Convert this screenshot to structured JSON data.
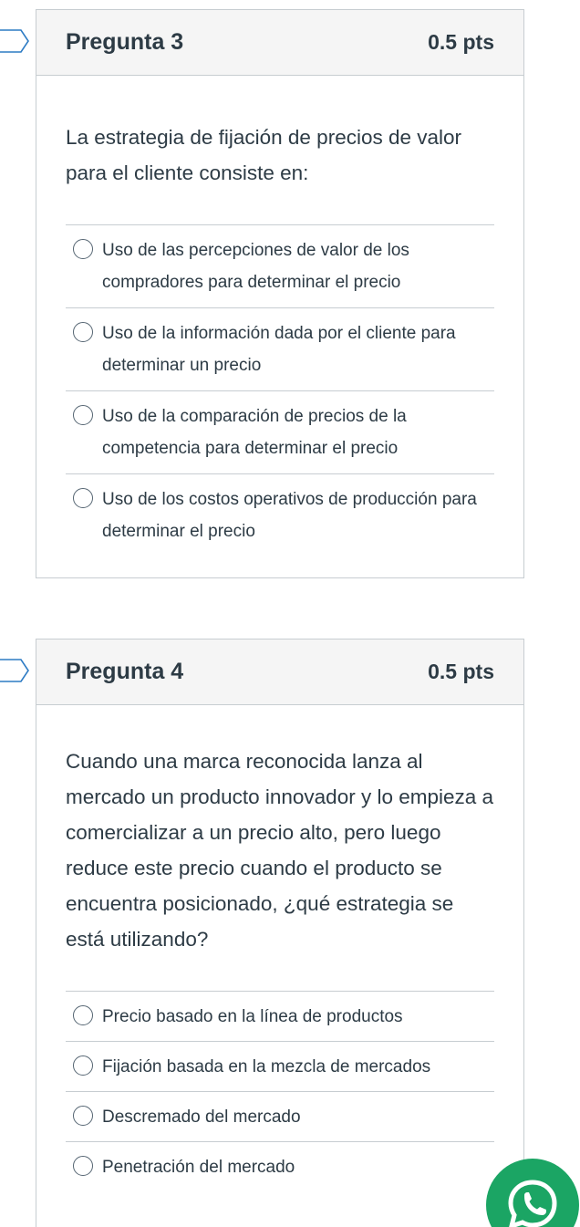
{
  "questions": [
    {
      "title": "Pregunta 3",
      "points": "0.5 pts",
      "text": "La estrategia de fijación de precios de valor para el cliente consiste en:",
      "answers": [
        "Uso de las percepciones de valor de los compradores para determinar el precio",
        "Uso de la información dada por el cliente para determinar un precio",
        "Uso de la comparación de precios de la competencia para determinar el precio",
        "Uso de los costos operativos de producción para determinar el precio"
      ]
    },
    {
      "title": "Pregunta 4",
      "points": "0.5 pts",
      "text": "Cuando una marca reconocida lanza al mercado un producto innovador y lo empieza a comercializar a un precio alto, pero luego reduce este precio cuando el producto se encuentra posicionado, ¿qué estrategia se está utilizando?",
      "answers": [
        "Precio basado en la línea de productos",
        "Fijación basada en la mezcla de mercados",
        "Descremado del mercado",
        "Penetración del mercado"
      ]
    }
  ],
  "icons": {
    "flag": "flag-question-icon",
    "chat": "whatsapp-icon"
  },
  "colors": {
    "header_bg": "#f5f5f5",
    "border": "#c7cdd1",
    "text": "#2d3b45",
    "whatsapp": "#1ba564"
  }
}
